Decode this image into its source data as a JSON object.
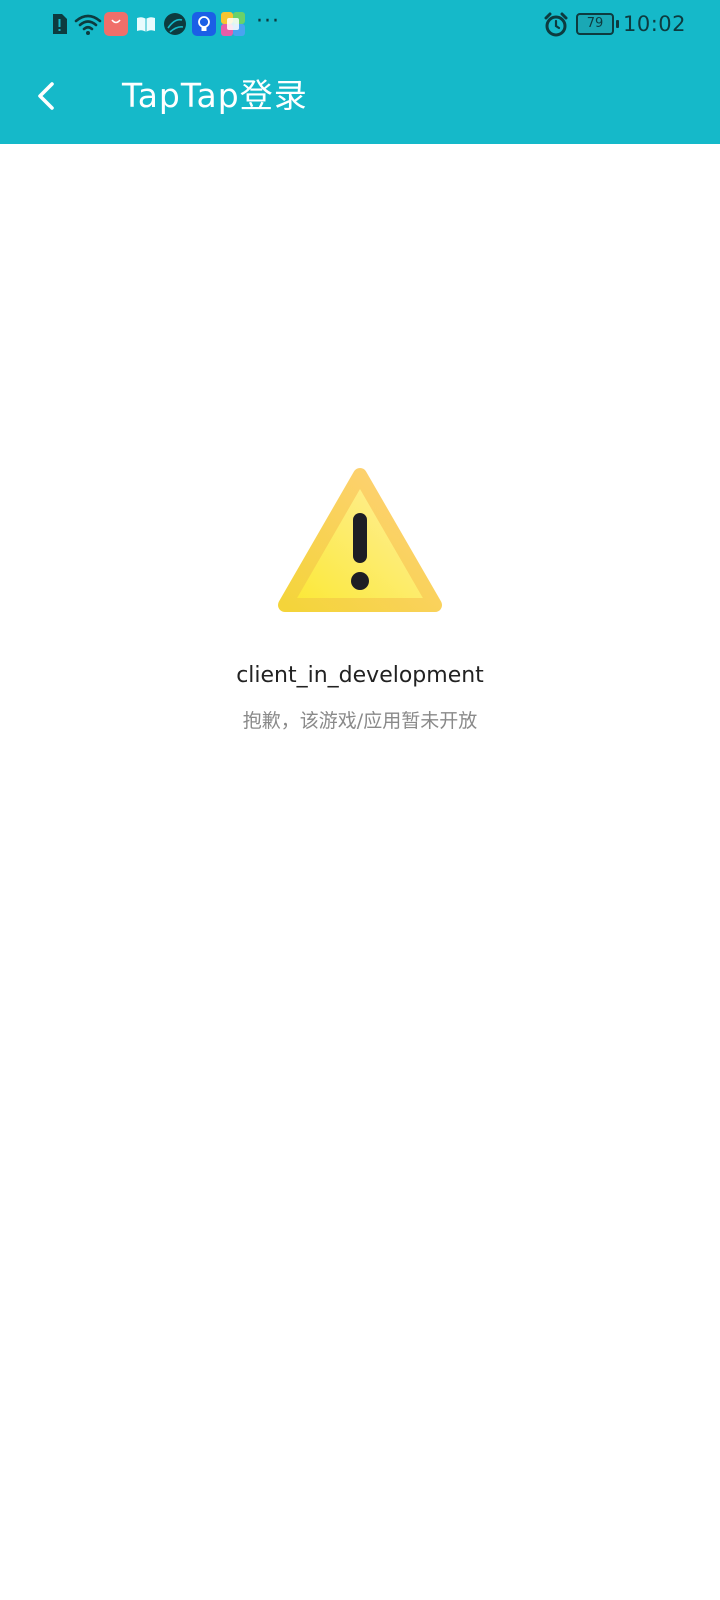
{
  "status_bar": {
    "icons": [
      "sim-alert-icon",
      "wifi-icon",
      "shopping-bag-icon",
      "book-icon",
      "globe-icon",
      "lightbulb-icon",
      "gallery-icon"
    ],
    "more": "···",
    "alarm_icon": "alarm-clock-icon",
    "battery": "79",
    "time": "10:02"
  },
  "header": {
    "back_icon": "chevron-left-icon",
    "title": "TapTap登录"
  },
  "content": {
    "icon": "warning-icon",
    "title": "client_in_development",
    "subtitle": "抱歉，该游戏/应用暂未开放"
  },
  "colors": {
    "header_bg": "#15b9c9",
    "icon_text": "#0d3b3f"
  }
}
